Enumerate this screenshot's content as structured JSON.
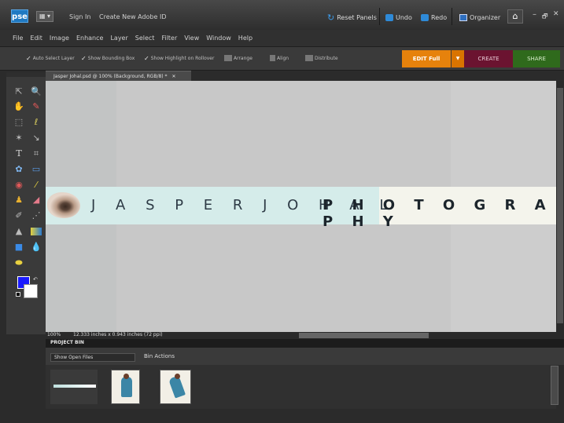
{
  "window": {
    "logo": "pse",
    "mode_label": "▦ ▾",
    "sign_in": "Sign In",
    "create_id": "Create New Adobe ID",
    "reset_panels": "Reset Panels",
    "undo": "Undo",
    "redo": "Redo",
    "organizer": "Organizer",
    "home_icon": "home-icon",
    "minimize": "–",
    "restore": "🗗",
    "close": "✕"
  },
  "menu": [
    "File",
    "Edit",
    "Image",
    "Enhance",
    "Layer",
    "Select",
    "Filter",
    "View",
    "Window",
    "Help"
  ],
  "options_bar": {
    "auto_select": "Auto Select Layer",
    "show_bbox": "Show Bounding Box",
    "show_highlight": "Show Highlight on Rollover",
    "arrange": "Arrange",
    "align": "Align",
    "distribute": "Distribute"
  },
  "mode_tabs": {
    "edit_full": "EDIT Full",
    "create": "CREATE",
    "share": "SHARE"
  },
  "document": {
    "tab_title": "Jasper Johal.psd @ 100% (Background, RGB/8) *",
    "tab_close": "✕",
    "zoom": "100%",
    "doc_info": "12.333 inches x 0.943 inches (72 ppi)"
  },
  "banner": {
    "name": "J A S P E R   J O H A L",
    "word": "P H O T O G R A P H Y"
  },
  "project_bin": {
    "title": "PROJECT BIN",
    "show_select": "Show Open Files",
    "bin_actions": "Bin Actions"
  },
  "colors": {
    "foreground": "#1a1aff",
    "background": "#ffffff",
    "edit_accent": "#e6820c",
    "create_accent": "#6b1330",
    "share_accent": "#2f6a1c"
  }
}
